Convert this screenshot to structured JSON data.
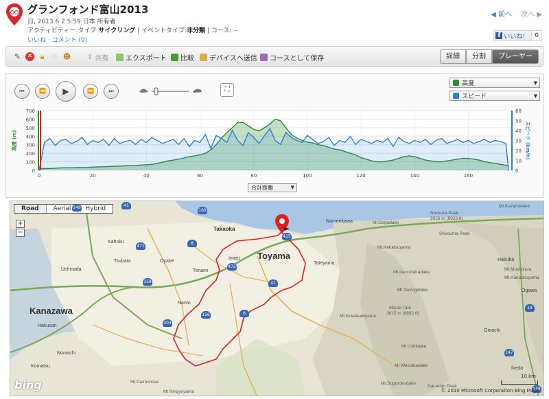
{
  "header": {
    "title": "グランフォンド富山2013",
    "date_line": "日, 2013 6 2 5:59 日本 所有者",
    "activity_label": "アクティビティー タイプ:",
    "activity_value": "サイクリング",
    "event_label": "| イベントタイプ:",
    "event_value": "非分類",
    "course_label": "| コース: --",
    "like_link": "いいね",
    "comment_link": "コメント (0)",
    "prev": "◀ 前へ",
    "next": "次へ ▶",
    "fb_like": "いいね！",
    "fb_count": "0",
    "fb_f": "f"
  },
  "toolbar": {
    "share": "共有",
    "export": "エクスポート",
    "compare": "比較",
    "send_device": "デバイスへ送信",
    "save_course": "コースとして保存",
    "tabs": [
      "詳細",
      "分割",
      "プレーヤー"
    ],
    "active_tab": "プレーヤー"
  },
  "player": {
    "series1": "高度",
    "series2": "スピード",
    "x_selector": "合計距離",
    "buttons": [
      "⏮",
      "⏪",
      "▶",
      "⏩",
      "⏭"
    ]
  },
  "chart_data": {
    "type": "area",
    "x": [
      0,
      2,
      4,
      6,
      8,
      10,
      12,
      14,
      16,
      18,
      20,
      22,
      24,
      26,
      28,
      30,
      32,
      34,
      36,
      38,
      40,
      42,
      44,
      46,
      48,
      50,
      52,
      54,
      56,
      58,
      60,
      62,
      64,
      66,
      68,
      70,
      72,
      74,
      76,
      78,
      80,
      82,
      84,
      86,
      88,
      90,
      92,
      94,
      96,
      98,
      100,
      102,
      104,
      106,
      108,
      110,
      112,
      114,
      116,
      118,
      120,
      122,
      124,
      126,
      128,
      130,
      132,
      134,
      136,
      138,
      140,
      142,
      144,
      146,
      148,
      150,
      152,
      154,
      156,
      158,
      160,
      162,
      164,
      166,
      168,
      170,
      172,
      174,
      175
    ],
    "series": [
      {
        "name": "高度",
        "color": "#2e8b2e",
        "axis": "left",
        "values": [
          20,
          20,
          22,
          25,
          28,
          30,
          30,
          32,
          34,
          35,
          38,
          40,
          42,
          45,
          48,
          50,
          52,
          55,
          58,
          62,
          65,
          70,
          80,
          95,
          110,
          120,
          130,
          145,
          160,
          170,
          180,
          200,
          240,
          300,
          380,
          440,
          500,
          560,
          560,
          520,
          480,
          460,
          500,
          540,
          600,
          580,
          500,
          420,
          380,
          350,
          330,
          320,
          300,
          290,
          270,
          250,
          240,
          220,
          200,
          180,
          150,
          130,
          110,
          100,
          100,
          110,
          120,
          140,
          160,
          170,
          160,
          140,
          120,
          110,
          100,
          100,
          110,
          120,
          130,
          140,
          140,
          130,
          120,
          100,
          90,
          80,
          70,
          60,
          50
        ]
      },
      {
        "name": "スピード",
        "color": "#2a7fe0",
        "axis": "right",
        "values": [
          0,
          28,
          32,
          25,
          30,
          31,
          27,
          29,
          33,
          26,
          30,
          28,
          31,
          25,
          32,
          27,
          29,
          30,
          26,
          31,
          28,
          33,
          30,
          27,
          29,
          31,
          26,
          32,
          24,
          30,
          28,
          36,
          22,
          35,
          32,
          28,
          40,
          30,
          25,
          38,
          33,
          27,
          35,
          42,
          30,
          26,
          38,
          33,
          30,
          28,
          35,
          31,
          27,
          29,
          33,
          25,
          30,
          28,
          34,
          26,
          31,
          29,
          27,
          30,
          28,
          32,
          24,
          33,
          29,
          27,
          30,
          28,
          31,
          26,
          30,
          32,
          27,
          29,
          31,
          28,
          30,
          27,
          29,
          31,
          28,
          30,
          29,
          27,
          0
        ]
      }
    ],
    "ylabel_left": "高度 (m)",
    "ylabel_right": "スピード (km/h)",
    "ylim_left": [
      0,
      700
    ],
    "ylim_right": [
      0,
      60
    ],
    "yticks_left": [
      "0",
      "100",
      "200",
      "300",
      "400",
      "500",
      "600",
      "700"
    ],
    "yticks_right": [
      "0",
      "10",
      "20",
      "30",
      "40",
      "50",
      "60"
    ],
    "xticks": [
      "0",
      "20",
      "40",
      "60",
      "80",
      "100",
      "120",
      "140",
      "160"
    ],
    "xlim": [
      0,
      176
    ],
    "grid": true
  },
  "map": {
    "tabs": [
      "Road",
      "Aerial",
      "Hybrid"
    ],
    "active_tab": "Road",
    "zoom_in": "+",
    "zoom_out": "−",
    "cities": [
      {
        "name": "Toyama",
        "size": 13
      },
      {
        "name": "Kanazawa",
        "size": 13
      },
      {
        "name": "Takaoka",
        "size": 8
      }
    ],
    "places": [
      "Kahoku",
      "Tsubata",
      "Uchinada",
      "Oyabe",
      "Tonami",
      "Nanto",
      "Imizu",
      "Hakusan",
      "Komatsu",
      "Nonoichi",
      "Tateyama",
      "Namerikawa",
      "Hakuba",
      "Ikeda",
      "Omachi",
      "Ogawa"
    ],
    "mountains": [
      "Mt.Sogadake",
      "Nonkura Peak",
      "3026 m (9928 ft)",
      "Shirouma Peak",
      "Mt.Kekatsuyama",
      "Mt.Ikenodairadake",
      "Mt.Tsurugidake",
      "Mount Tate",
      "3015 m (9892 ft)",
      "Mt.Kuwasakiyama",
      "Mt.Ushidake",
      "Mt.Washibadake",
      "Mt.Sugorokudake",
      "Dai-tenjo Peak",
      "Mt.Daimonzan",
      "Mt.Ningyoyama",
      "Mt.Kazaruidake",
      "Mt.Mushikura",
      "Mt.Kanaokuyama"
    ],
    "roads": [
      "160",
      "415",
      "8",
      "471",
      "472",
      "41",
      "359",
      "304",
      "156",
      "8",
      "41",
      "147",
      "148",
      "19",
      "249"
    ],
    "bing": "bing",
    "copyright": "© 2010 Microsoft Corporation  Bing Maps",
    "scale": "10 km"
  }
}
